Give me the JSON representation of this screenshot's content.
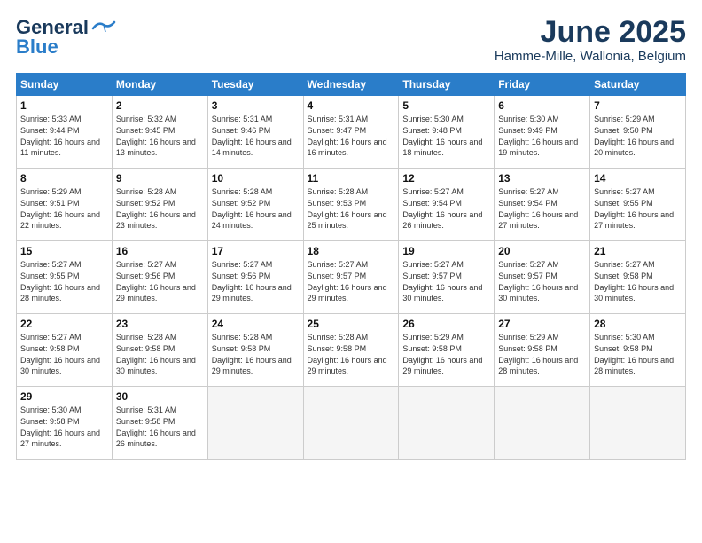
{
  "logo": {
    "line1": "General",
    "line2": "Blue"
  },
  "title": "June 2025",
  "subtitle": "Hamme-Mille, Wallonia, Belgium",
  "headers": [
    "Sunday",
    "Monday",
    "Tuesday",
    "Wednesday",
    "Thursday",
    "Friday",
    "Saturday"
  ],
  "weeks": [
    [
      {
        "day": "1",
        "sunrise": "Sunrise: 5:33 AM",
        "sunset": "Sunset: 9:44 PM",
        "daylight": "Daylight: 16 hours and 11 minutes."
      },
      {
        "day": "2",
        "sunrise": "Sunrise: 5:32 AM",
        "sunset": "Sunset: 9:45 PM",
        "daylight": "Daylight: 16 hours and 13 minutes."
      },
      {
        "day": "3",
        "sunrise": "Sunrise: 5:31 AM",
        "sunset": "Sunset: 9:46 PM",
        "daylight": "Daylight: 16 hours and 14 minutes."
      },
      {
        "day": "4",
        "sunrise": "Sunrise: 5:31 AM",
        "sunset": "Sunset: 9:47 PM",
        "daylight": "Daylight: 16 hours and 16 minutes."
      },
      {
        "day": "5",
        "sunrise": "Sunrise: 5:30 AM",
        "sunset": "Sunset: 9:48 PM",
        "daylight": "Daylight: 16 hours and 18 minutes."
      },
      {
        "day": "6",
        "sunrise": "Sunrise: 5:30 AM",
        "sunset": "Sunset: 9:49 PM",
        "daylight": "Daylight: 16 hours and 19 minutes."
      },
      {
        "day": "7",
        "sunrise": "Sunrise: 5:29 AM",
        "sunset": "Sunset: 9:50 PM",
        "daylight": "Daylight: 16 hours and 20 minutes."
      }
    ],
    [
      {
        "day": "8",
        "sunrise": "Sunrise: 5:29 AM",
        "sunset": "Sunset: 9:51 PM",
        "daylight": "Daylight: 16 hours and 22 minutes."
      },
      {
        "day": "9",
        "sunrise": "Sunrise: 5:28 AM",
        "sunset": "Sunset: 9:52 PM",
        "daylight": "Daylight: 16 hours and 23 minutes."
      },
      {
        "day": "10",
        "sunrise": "Sunrise: 5:28 AM",
        "sunset": "Sunset: 9:52 PM",
        "daylight": "Daylight: 16 hours and 24 minutes."
      },
      {
        "day": "11",
        "sunrise": "Sunrise: 5:28 AM",
        "sunset": "Sunset: 9:53 PM",
        "daylight": "Daylight: 16 hours and 25 minutes."
      },
      {
        "day": "12",
        "sunrise": "Sunrise: 5:27 AM",
        "sunset": "Sunset: 9:54 PM",
        "daylight": "Daylight: 16 hours and 26 minutes."
      },
      {
        "day": "13",
        "sunrise": "Sunrise: 5:27 AM",
        "sunset": "Sunset: 9:54 PM",
        "daylight": "Daylight: 16 hours and 27 minutes."
      },
      {
        "day": "14",
        "sunrise": "Sunrise: 5:27 AM",
        "sunset": "Sunset: 9:55 PM",
        "daylight": "Daylight: 16 hours and 27 minutes."
      }
    ],
    [
      {
        "day": "15",
        "sunrise": "Sunrise: 5:27 AM",
        "sunset": "Sunset: 9:55 PM",
        "daylight": "Daylight: 16 hours and 28 minutes."
      },
      {
        "day": "16",
        "sunrise": "Sunrise: 5:27 AM",
        "sunset": "Sunset: 9:56 PM",
        "daylight": "Daylight: 16 hours and 29 minutes."
      },
      {
        "day": "17",
        "sunrise": "Sunrise: 5:27 AM",
        "sunset": "Sunset: 9:56 PM",
        "daylight": "Daylight: 16 hours and 29 minutes."
      },
      {
        "day": "18",
        "sunrise": "Sunrise: 5:27 AM",
        "sunset": "Sunset: 9:57 PM",
        "daylight": "Daylight: 16 hours and 29 minutes."
      },
      {
        "day": "19",
        "sunrise": "Sunrise: 5:27 AM",
        "sunset": "Sunset: 9:57 PM",
        "daylight": "Daylight: 16 hours and 30 minutes."
      },
      {
        "day": "20",
        "sunrise": "Sunrise: 5:27 AM",
        "sunset": "Sunset: 9:57 PM",
        "daylight": "Daylight: 16 hours and 30 minutes."
      },
      {
        "day": "21",
        "sunrise": "Sunrise: 5:27 AM",
        "sunset": "Sunset: 9:58 PM",
        "daylight": "Daylight: 16 hours and 30 minutes."
      }
    ],
    [
      {
        "day": "22",
        "sunrise": "Sunrise: 5:27 AM",
        "sunset": "Sunset: 9:58 PM",
        "daylight": "Daylight: 16 hours and 30 minutes."
      },
      {
        "day": "23",
        "sunrise": "Sunrise: 5:28 AM",
        "sunset": "Sunset: 9:58 PM",
        "daylight": "Daylight: 16 hours and 30 minutes."
      },
      {
        "day": "24",
        "sunrise": "Sunrise: 5:28 AM",
        "sunset": "Sunset: 9:58 PM",
        "daylight": "Daylight: 16 hours and 29 minutes."
      },
      {
        "day": "25",
        "sunrise": "Sunrise: 5:28 AM",
        "sunset": "Sunset: 9:58 PM",
        "daylight": "Daylight: 16 hours and 29 minutes."
      },
      {
        "day": "26",
        "sunrise": "Sunrise: 5:29 AM",
        "sunset": "Sunset: 9:58 PM",
        "daylight": "Daylight: 16 hours and 29 minutes."
      },
      {
        "day": "27",
        "sunrise": "Sunrise: 5:29 AM",
        "sunset": "Sunset: 9:58 PM",
        "daylight": "Daylight: 16 hours and 28 minutes."
      },
      {
        "day": "28",
        "sunrise": "Sunrise: 5:30 AM",
        "sunset": "Sunset: 9:58 PM",
        "daylight": "Daylight: 16 hours and 28 minutes."
      }
    ],
    [
      {
        "day": "29",
        "sunrise": "Sunrise: 5:30 AM",
        "sunset": "Sunset: 9:58 PM",
        "daylight": "Daylight: 16 hours and 27 minutes."
      },
      {
        "day": "30",
        "sunrise": "Sunrise: 5:31 AM",
        "sunset": "Sunset: 9:58 PM",
        "daylight": "Daylight: 16 hours and 26 minutes."
      },
      null,
      null,
      null,
      null,
      null
    ]
  ]
}
